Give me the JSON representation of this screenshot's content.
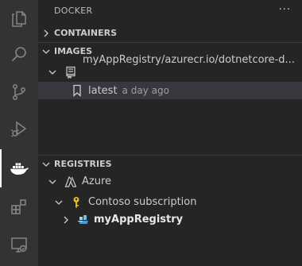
{
  "activity_bar": {
    "items": [
      {
        "icon": "files-icon"
      },
      {
        "icon": "search-icon"
      },
      {
        "icon": "source-control-icon"
      },
      {
        "icon": "run-debug-icon"
      },
      {
        "icon": "docker-icon",
        "active": true
      },
      {
        "icon": "extensions-icon"
      },
      {
        "icon": "remote-explorer-icon"
      }
    ]
  },
  "sidebar": {
    "title": "DOCKER",
    "more_label": "···",
    "sections": {
      "containers": {
        "label": "CONTAINERS"
      },
      "images": {
        "label": "IMAGES",
        "repository_label": "myAppRegistry/azurecr.io/dotnetcore-d...",
        "tag_label": "latest",
        "tag_description": "a day ago"
      },
      "registries": {
        "label": "REGISTRIES",
        "provider_label": "Azure",
        "subscription_label": "Contoso subscription",
        "registry_label": "myAppRegistry"
      }
    }
  },
  "colors": {
    "background": "#252526",
    "activity_bar": "#333333",
    "selection": "#37373d",
    "key_icon": "#e8b71a",
    "registry_icon": "#3ba0d8"
  }
}
